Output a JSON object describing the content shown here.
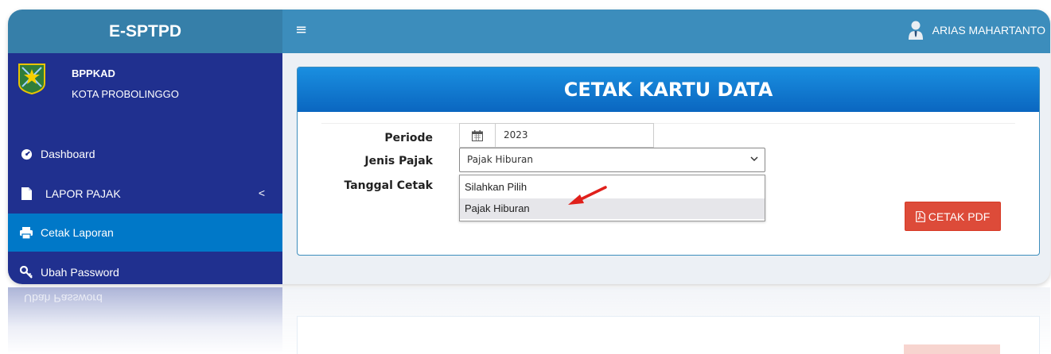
{
  "brand": {
    "title": "E-SPTPD"
  },
  "topbar": {
    "menu_toggle": "≡",
    "user_name": "ARIAS MAHARTANTO"
  },
  "sidebar": {
    "org_line1": "BPPKAD",
    "org_line2": "KOTA PROBOLINGGO",
    "items": [
      {
        "label": "Dashboard",
        "icon": "dashboard-icon"
      },
      {
        "label": "LAPOR PAJAK",
        "icon": "file-icon",
        "chevron": "<"
      },
      {
        "label": "Cetak Laporan",
        "icon": "print-icon",
        "active": true
      },
      {
        "label": "Ubah Password",
        "icon": "key-icon"
      }
    ],
    "reflection_text": "Ubah Password"
  },
  "form": {
    "title": "CETAK KARTU DATA",
    "periode_label": "Periode",
    "periode_value": "2023",
    "jenis_label": "Jenis Pajak",
    "jenis_value": "Pajak Hiburan",
    "tanggal_label": "Tanggal Cetak",
    "options": [
      "Silahkan Pilih",
      "Pajak Hiburan"
    ],
    "selected_option": "Pajak Hiburan",
    "cetak_pdf_label": "CETAK PDF"
  },
  "colors": {
    "brand": "#367fa9",
    "topbar": "#3c8dbc",
    "sidebar": "#20308f",
    "active_item": "#0078c8",
    "button_danger": "#dd4b39",
    "annotation_arrow": "#e0201b"
  }
}
